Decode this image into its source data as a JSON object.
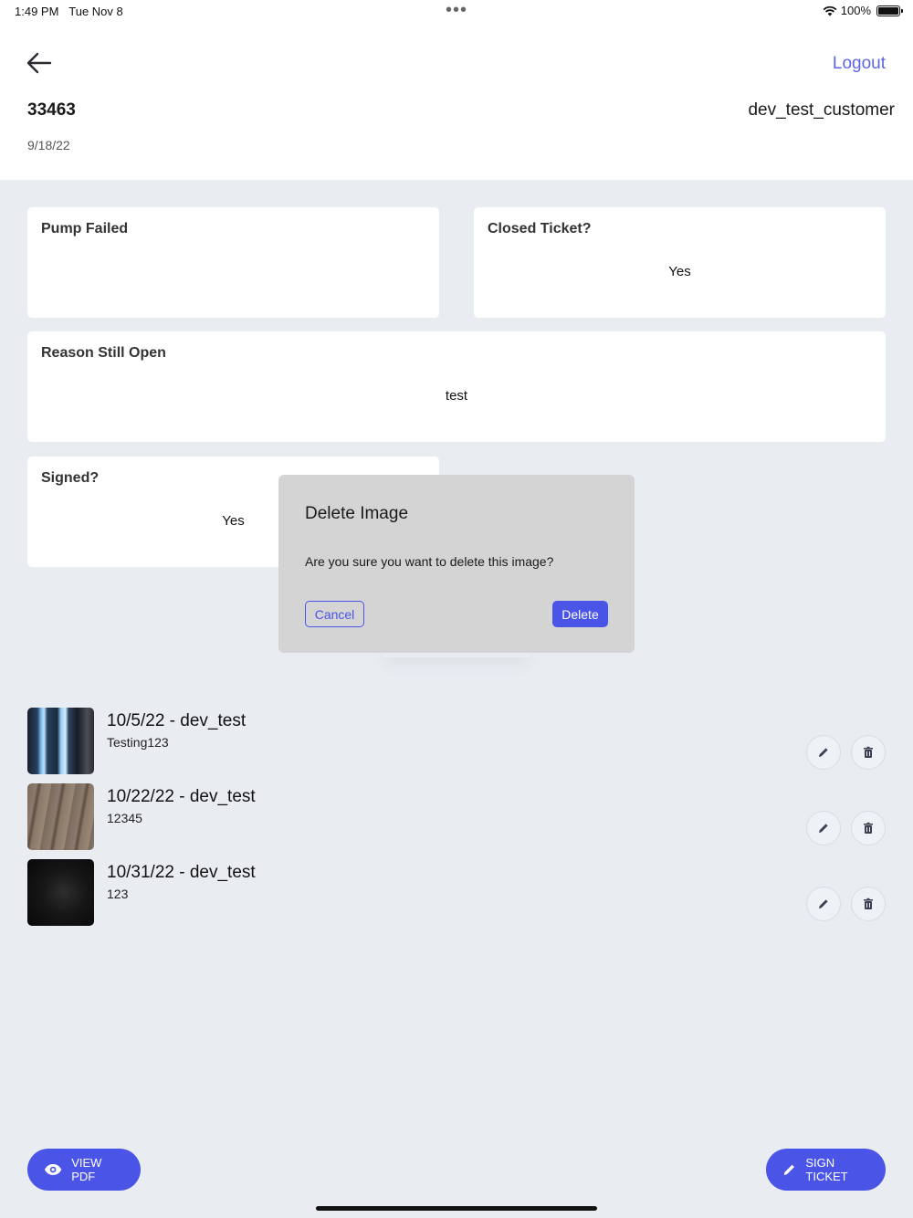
{
  "status_bar": {
    "time": "1:49 PM",
    "date": "Tue Nov 8",
    "dots": "•••",
    "battery": "100%"
  },
  "header": {
    "logout_label": "Logout",
    "ticket_id": "33463",
    "customer": "dev_test_customer",
    "date": "9/18/22"
  },
  "cards": {
    "pump_failed": {
      "title": "Pump Failed",
      "value": ""
    },
    "closed_ticket": {
      "title": "Closed Ticket?",
      "value": "Yes"
    },
    "reason_open": {
      "title": "Reason Still Open",
      "value": "test"
    },
    "signed": {
      "title": "Signed?",
      "value": "Yes"
    }
  },
  "images": [
    {
      "title": "10/5/22 - dev_test",
      "subtitle": "Testing123"
    },
    {
      "title": "10/22/22 - dev_test",
      "subtitle": "12345"
    },
    {
      "title": "10/31/22 - dev_test",
      "subtitle": "123"
    }
  ],
  "actions": {
    "view_pdf": "VIEW PDF",
    "sign_ticket": "SIGN TICKET"
  },
  "dialog": {
    "title": "Delete Image",
    "message": "Are you sure you want to delete this image?",
    "cancel": "Cancel",
    "confirm": "Delete"
  },
  "colors": {
    "accent": "#4a55e8",
    "background": "#e9edf2",
    "dialog": "#d4d4d4"
  },
  "icons": [
    "back-arrow-icon",
    "wifi-icon",
    "battery-icon",
    "pencil-icon",
    "trash-icon",
    "eye-icon"
  ]
}
